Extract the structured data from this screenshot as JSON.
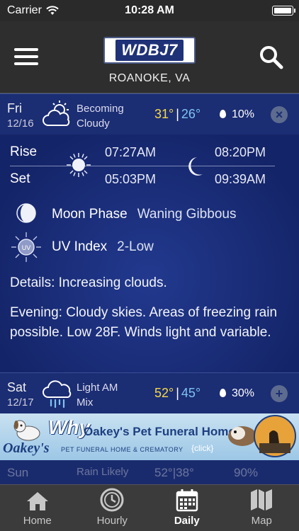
{
  "status_bar": {
    "carrier": "Carrier",
    "time": "10:28 AM"
  },
  "header": {
    "logo_text": "WDBJ7",
    "location": "ROANOKE, VA"
  },
  "days": [
    {
      "day": "Fri",
      "date": "12/16",
      "condition_line1": "Becoming",
      "condition_line2": "Cloudy",
      "high": "31°",
      "low": "26°",
      "precip": "10%",
      "icon": "partly-sunny-icon",
      "toggle": "×"
    },
    {
      "day": "Sat",
      "date": "12/17",
      "condition_line1": "Light AM",
      "condition_line2": "Mix",
      "high": "52°",
      "low": "45°",
      "precip": "30%",
      "icon": "freezing-rain-icon",
      "toggle": "+"
    }
  ],
  "peek_day": {
    "day": "Sun",
    "condition": "Rain Likely",
    "temps": "52°|38°",
    "precip": "90%"
  },
  "detail": {
    "rise_label": "Rise",
    "set_label": "Set",
    "sunrise": "07:27AM",
    "sunset": "05:03PM",
    "moonrise": "08:20PM",
    "moonset": "09:39AM",
    "moon_phase_label": "Moon Phase",
    "moon_phase_value": "Waning Gibbous",
    "uv_label": "UV Index",
    "uv_value": "2-Low",
    "uv_badge": "UV",
    "details": "Details: Increasing clouds.",
    "evening": "Evening: Cloudy skies. Areas of freezing rain possible. Low 28F. Winds light and variable."
  },
  "ad": {
    "why": "Why",
    "title": "Oakey's Pet Funeral Home?",
    "brand": "Oakey's",
    "subtitle": "PET FUNERAL HOME & CREMATORY",
    "click": "{click}"
  },
  "tabs": [
    {
      "label": "Home",
      "icon": "home-icon"
    },
    {
      "label": "Hourly",
      "icon": "clock-icon"
    },
    {
      "label": "Daily",
      "icon": "calendar-icon"
    },
    {
      "label": "Map",
      "icon": "map-icon"
    }
  ],
  "colors": {
    "high_temp": "#f5d94a",
    "low_temp": "#7fc3f0",
    "panel_bg": "#1b2d73",
    "header_bg": "#2e2e2e",
    "tabbar_bg": "#3b3b3b"
  }
}
